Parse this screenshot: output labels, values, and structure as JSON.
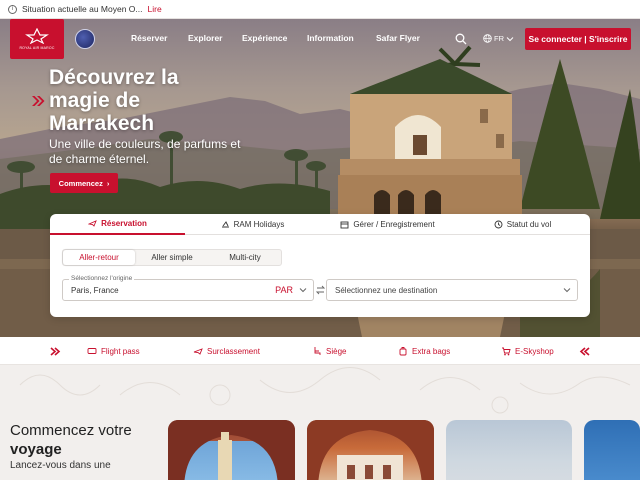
{
  "alert": {
    "text": "Situation actuelle au Moyen O...",
    "link": "Lire"
  },
  "header": {
    "logo_text": "ROYAL AIR MAROC",
    "nav": [
      "Réserver",
      "Explorer",
      "Expérience",
      "Information",
      "Safar Flyer"
    ],
    "language": "FR",
    "connect_label": "Se connecter | S'inscrire"
  },
  "hero": {
    "title": "Découvrez la magie de Marrakech",
    "subtitle": "Une ville de couleurs, de parfums et de charme éternel.",
    "cta": "Commencez"
  },
  "booking": {
    "tabs": [
      "Réservation",
      "RAM Holidays",
      "Gérer / Enregistrement",
      "Statut du vol"
    ],
    "active_tab": "Réservation",
    "trip_types": [
      "Aller-retour",
      "Aller simple",
      "Multi-city"
    ],
    "active_trip_type": "Aller-retour",
    "origin": {
      "label": "Sélectionnez l'origine",
      "value": "Paris, France",
      "code": "PAR"
    },
    "destination": {
      "placeholder": "Sélectionnez une destination"
    }
  },
  "services": [
    "Flight pass",
    "Surclassement",
    "Siège",
    "Extra bags",
    "E-Skyshop"
  ],
  "lower": {
    "title_line1": "Commencez votre",
    "title_line2": "voyage",
    "subtitle": "Lancez-vous dans une"
  },
  "colors": {
    "brand_red": "#c8102e",
    "white": "#ffffff"
  }
}
